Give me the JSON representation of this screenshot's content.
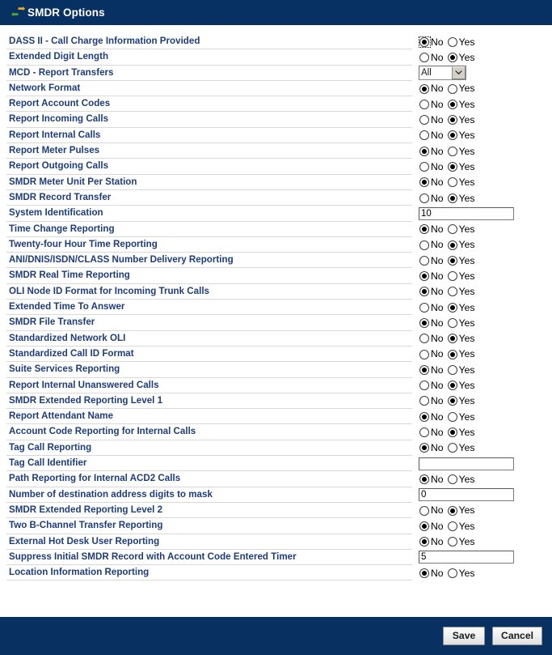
{
  "window": {
    "title": "SMDR Options",
    "title_icon": "bidirectional-transfer-arrows-icon",
    "header_bg": "#083163",
    "footer_bg": "#083161",
    "label_color": "#1F3D7A"
  },
  "form": {
    "rows": [
      {
        "label": "DASS II - Call Charge Information Provided",
        "type": "radio",
        "value": "No",
        "focused": true
      },
      {
        "label": "Extended Digit Length",
        "type": "radio",
        "value": "Yes",
        "focused": false
      },
      {
        "label": "MCD - Report Transfers",
        "type": "select",
        "value": "All"
      },
      {
        "label": "Network Format",
        "type": "radio",
        "value": "No",
        "focused": false
      },
      {
        "label": "Report Account Codes",
        "type": "radio",
        "value": "Yes",
        "focused": false
      },
      {
        "label": "Report Incoming Calls",
        "type": "radio",
        "value": "Yes",
        "focused": false
      },
      {
        "label": "Report Internal Calls",
        "type": "radio",
        "value": "Yes",
        "focused": false
      },
      {
        "label": "Report Meter Pulses",
        "type": "radio",
        "value": "No",
        "focused": false
      },
      {
        "label": "Report Outgoing Calls",
        "type": "radio",
        "value": "Yes",
        "focused": false
      },
      {
        "label": "SMDR Meter Unit Per Station",
        "type": "radio",
        "value": "No",
        "focused": false
      },
      {
        "label": "SMDR Record Transfer",
        "type": "radio",
        "value": "Yes",
        "focused": false
      },
      {
        "label": "System Identification",
        "type": "text",
        "value": "10"
      },
      {
        "label": "Time Change Reporting",
        "type": "radio",
        "value": "No",
        "focused": false
      },
      {
        "label": "Twenty-four Hour Time Reporting",
        "type": "radio",
        "value": "Yes",
        "focused": false
      },
      {
        "label": "ANI/DNIS/ISDN/CLASS Number Delivery Reporting",
        "type": "radio",
        "value": "Yes",
        "focused": false
      },
      {
        "label": "SMDR Real Time Reporting",
        "type": "radio",
        "value": "No",
        "focused": false
      },
      {
        "label": "OLI Node ID Format for Incoming Trunk Calls",
        "type": "radio",
        "value": "No",
        "focused": false
      },
      {
        "label": "Extended Time To Answer",
        "type": "radio",
        "value": "Yes",
        "focused": false
      },
      {
        "label": "SMDR File Transfer",
        "type": "radio",
        "value": "No",
        "focused": false
      },
      {
        "label": "Standardized Network OLI",
        "type": "radio",
        "value": "Yes",
        "focused": false
      },
      {
        "label": "Standardized Call ID Format",
        "type": "radio",
        "value": "Yes",
        "focused": false
      },
      {
        "label": "Suite Services Reporting",
        "type": "radio",
        "value": "No",
        "focused": false
      },
      {
        "label": "Report Internal Unanswered Calls",
        "type": "radio",
        "value": "Yes",
        "focused": false
      },
      {
        "label": "SMDR Extended Reporting Level 1",
        "type": "radio",
        "value": "Yes",
        "focused": false
      },
      {
        "label": "Report Attendant Name",
        "type": "radio",
        "value": "No",
        "focused": false
      },
      {
        "label": "Account Code Reporting for Internal Calls",
        "type": "radio",
        "value": "Yes",
        "focused": false
      },
      {
        "label": "Tag Call Reporting",
        "type": "radio",
        "value": "No",
        "focused": false
      },
      {
        "label": "Tag Call Identifier",
        "type": "text",
        "value": ""
      },
      {
        "label": "Path Reporting for Internal ACD2 Calls",
        "type": "radio",
        "value": "No",
        "focused": false
      },
      {
        "label": "Number of destination address digits to mask",
        "type": "text",
        "value": "0"
      },
      {
        "label": "SMDR Extended Reporting Level 2",
        "type": "radio",
        "value": "Yes",
        "focused": false
      },
      {
        "label": "Two B-Channel Transfer Reporting",
        "type": "radio",
        "value": "No",
        "focused": false
      },
      {
        "label": "External Hot Desk User Reporting",
        "type": "radio",
        "value": "No",
        "focused": false
      },
      {
        "label": "Suppress Initial SMDR Record with Account Code Entered Timer",
        "type": "text",
        "value": "5"
      },
      {
        "label": "Location Information Reporting",
        "type": "radio",
        "value": "No",
        "focused": false
      }
    ],
    "radio_options": [
      "No",
      "Yes"
    ]
  },
  "footer": {
    "save_label": "Save",
    "cancel_label": "Cancel"
  }
}
